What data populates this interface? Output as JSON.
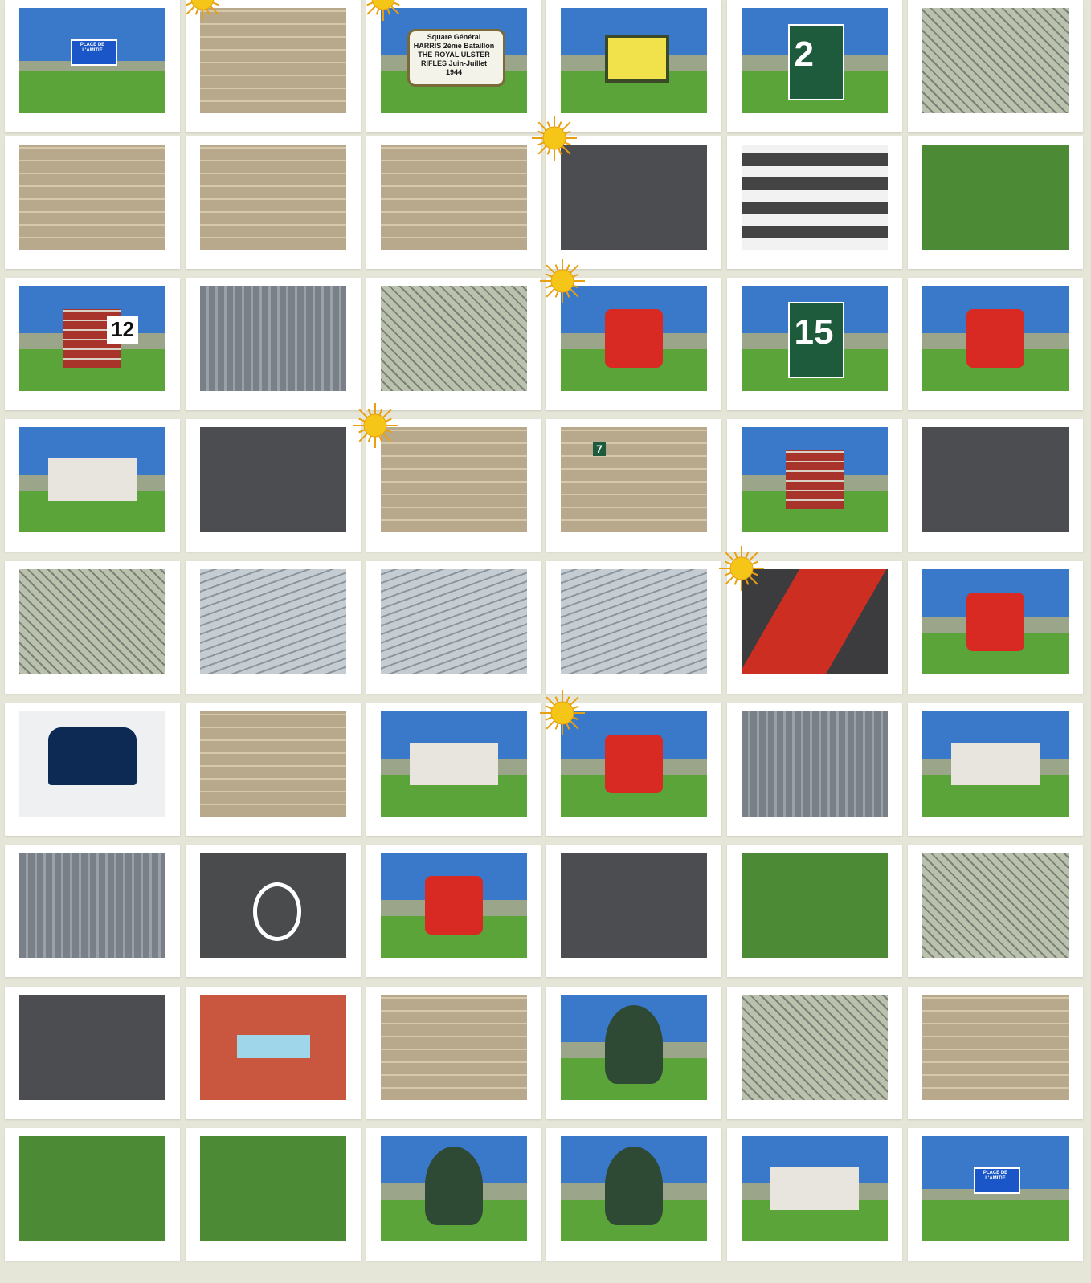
{
  "gallery": {
    "rows": 9,
    "columns": 6,
    "photos": [
      {
        "name": "street-sign-place-de-lamitie",
        "style": "sign",
        "text": "PLACE DE L'AMITIÉ"
      },
      {
        "name": "stone-wall-path",
        "style": "wall",
        "text": ""
      },
      {
        "name": "plaque-square-general-harris",
        "style": "plaque",
        "text": "Square Général HARRIS 2ème Bataillon THE ROYAL ULSTER RIFLES Juin-Juillet 1944"
      },
      {
        "name": "yellow-tree-plaque",
        "style": "yellow",
        "text": ""
      },
      {
        "name": "house-number-2",
        "style": "num",
        "text": "2"
      },
      {
        "name": "gate-post-mesh",
        "style": "fence",
        "text": ""
      },
      {
        "name": "stone-wall-alley",
        "style": "wall",
        "text": ""
      },
      {
        "name": "wall-slot-opening",
        "style": "wall",
        "text": ""
      },
      {
        "name": "stone-facade-windows",
        "style": "wall",
        "text": ""
      },
      {
        "name": "concrete-curb-shadow",
        "style": "asphalt",
        "text": ""
      },
      {
        "name": "crosswalk-stripes",
        "style": "stripes",
        "text": ""
      },
      {
        "name": "green-barrier",
        "style": "green",
        "text": ""
      },
      {
        "name": "brick-pillar-number-12",
        "style": "brick",
        "text": "12"
      },
      {
        "name": "grey-composite-fence",
        "style": "vslats",
        "text": ""
      },
      {
        "name": "leaning-post-hedge",
        "style": "fence",
        "text": ""
      },
      {
        "name": "red-bollard-lawn",
        "style": "red",
        "text": ""
      },
      {
        "name": "house-number-15-mirror",
        "style": "num",
        "text": "15"
      },
      {
        "name": "red-bollard-shadow",
        "style": "red",
        "text": ""
      },
      {
        "name": "house-roofs-hedge",
        "style": "house",
        "text": ""
      },
      {
        "name": "manhole-cover-grass",
        "style": "asphalt",
        "text": ""
      },
      {
        "name": "balustrade-columns",
        "style": "wall",
        "text": ""
      },
      {
        "name": "stone-pillar-number-7",
        "style": "wall",
        "text": "7"
      },
      {
        "name": "brick-pillar-street",
        "style": "brick",
        "text": ""
      },
      {
        "name": "mail-slot",
        "style": "asphalt",
        "text": ""
      },
      {
        "name": "wooden-fence-path",
        "style": "fence",
        "text": ""
      },
      {
        "name": "downpipe-heart",
        "style": "siding",
        "text": ""
      },
      {
        "name": "metal-railing-panel",
        "style": "siding",
        "text": ""
      },
      {
        "name": "siding-bracket",
        "style": "siding",
        "text": ""
      },
      {
        "name": "red-running-track",
        "style": "track",
        "text": ""
      },
      {
        "name": "red-white-post",
        "style": "red",
        "text": ""
      },
      {
        "name": "car-road-sign",
        "style": "carsign",
        "text": ""
      },
      {
        "name": "white-wall-bark",
        "style": "wall",
        "text": ""
      },
      {
        "name": "new-houses-gravel-path",
        "style": "house",
        "text": ""
      },
      {
        "name": "red-fire-hydrant-closeup",
        "style": "red",
        "text": ""
      },
      {
        "name": "decorative-fence-panel",
        "style": "vslats",
        "text": ""
      },
      {
        "name": "house-window-grey-wall",
        "style": "house",
        "text": ""
      },
      {
        "name": "vertical-slat-fence",
        "style": "vslats",
        "text": ""
      },
      {
        "name": "bicycle-lane-marking",
        "style": "bike",
        "text": ""
      },
      {
        "name": "red-fire-hydrant",
        "style": "red",
        "text": ""
      },
      {
        "name": "asphalt-markers",
        "style": "asphalt",
        "text": ""
      },
      {
        "name": "wooden-post-path",
        "style": "green",
        "text": ""
      },
      {
        "name": "broken-fence-hedge",
        "style": "fence",
        "text": ""
      },
      {
        "name": "utility-cover",
        "style": "asphalt",
        "text": ""
      },
      {
        "name": "arrow-sign",
        "style": "arrow",
        "text": ""
      },
      {
        "name": "concrete-lattice",
        "style": "wall",
        "text": ""
      },
      {
        "name": "conifer-tree",
        "style": "tree",
        "text": ""
      },
      {
        "name": "chainlink-fence",
        "style": "fence",
        "text": ""
      },
      {
        "name": "log-palisade",
        "style": "wall",
        "text": ""
      },
      {
        "name": "red-hydrant-park",
        "style": "green",
        "text": ""
      },
      {
        "name": "rustic-fence-grass",
        "style": "green",
        "text": ""
      },
      {
        "name": "weeping-tree-lawn",
        "style": "tree",
        "text": ""
      },
      {
        "name": "tree-trunk-lawn",
        "style": "tree",
        "text": ""
      },
      {
        "name": "houses-bare-trees",
        "style": "house",
        "text": ""
      },
      {
        "name": "street-sign-place-de-lamitie-2",
        "style": "sign",
        "text": "PLACE DE L'AMITIÉ"
      }
    ],
    "suns": [
      {
        "row": 0,
        "col": 1
      },
      {
        "row": 0,
        "col": 2
      },
      {
        "row": 1,
        "col": 3
      },
      {
        "row": 2,
        "col": 3
      },
      {
        "row": 3,
        "col": 2
      },
      {
        "row": 4,
        "col": 4
      },
      {
        "row": 5,
        "col": 3
      }
    ]
  },
  "colors": {
    "background": "#e6e6d8",
    "card": "#ffffff",
    "sun": "#f5c518"
  }
}
